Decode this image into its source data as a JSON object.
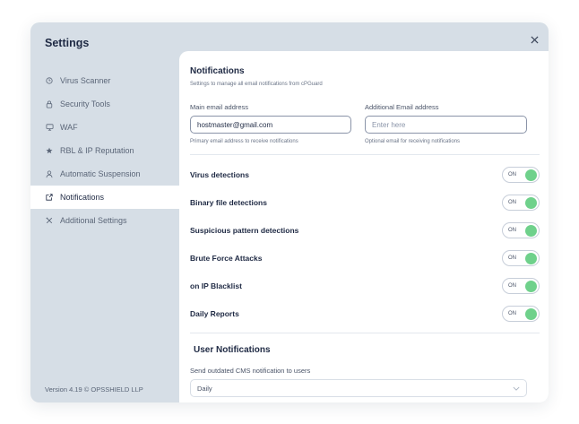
{
  "window": {
    "title": "Settings"
  },
  "sidebar": {
    "items": [
      {
        "label": "Virus Scanner",
        "icon": "clock-icon"
      },
      {
        "label": "Security Tools",
        "icon": "lock-icon"
      },
      {
        "label": "WAF",
        "icon": "monitor-icon"
      },
      {
        "label": "RBL & IP Reputation",
        "icon": "star-icon"
      },
      {
        "label": "Automatic Suspension",
        "icon": "user-icon"
      },
      {
        "label": "Notifications",
        "icon": "external-link-icon",
        "active": true
      },
      {
        "label": "Additional Settings",
        "icon": "tools-icon"
      }
    ],
    "version": "Version 4.19 © OPSSHIELD LLP"
  },
  "notifications": {
    "title": "Notifications",
    "subtitle": "Settings to manage all email notifications from cPGuard",
    "main_email": {
      "label": "Main email address",
      "value": "hostmaster@gmail.com",
      "help": "Primary email address to receive notifications"
    },
    "additional_email": {
      "label": "Additional Email address",
      "placeholder": "Enter here",
      "help": "Optional email for receiving notifications"
    },
    "toggles": [
      {
        "label": "Virus detections",
        "state": "ON"
      },
      {
        "label": "Binary file detections",
        "state": "ON"
      },
      {
        "label": "Suspicious pattern detections",
        "state": "ON"
      },
      {
        "label": "Brute Force Attacks",
        "state": "ON"
      },
      {
        "label": "on IP Blacklist",
        "state": "ON"
      },
      {
        "label": "Daily Reports",
        "state": "ON"
      }
    ]
  },
  "user_notifications": {
    "title": "User Notifications",
    "cms_label": "Send outdated CMS notification to users",
    "cms_value": "Daily"
  },
  "colors": {
    "sidebar_bg": "#d6dee6",
    "accent_on": "#6fd18b",
    "text_dark": "#1f2a44"
  }
}
